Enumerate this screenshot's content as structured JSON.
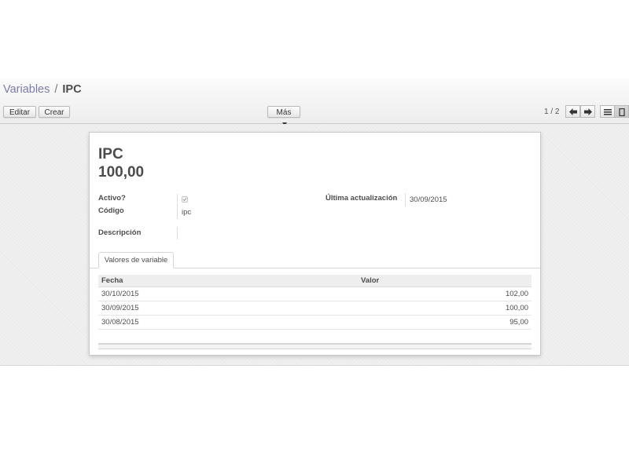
{
  "breadcrumb": {
    "parent": "Variables",
    "separator": "/",
    "current": "IPC"
  },
  "toolbar": {
    "edit_label": "Editar",
    "create_label": "Crear",
    "more_label": "Más"
  },
  "pager": {
    "text": "1 / 2"
  },
  "record": {
    "name": "IPC",
    "value": "100,00",
    "fields": {
      "active_label": "Activo?",
      "active_checked": true,
      "code_label": "Código",
      "code_value": "ipc",
      "description_label": "Descripción",
      "description_value": "",
      "last_update_label": "Última actualización",
      "last_update_value": "30/09/2015"
    }
  },
  "tabs": [
    {
      "label": "Valores de variable"
    }
  ],
  "table": {
    "columns": [
      "Fecha",
      "Valor"
    ],
    "rows": [
      [
        "30/10/2015",
        "102,00"
      ],
      [
        "30/09/2015",
        "100,00"
      ],
      [
        "30/08/2015",
        "95,00"
      ]
    ]
  }
}
